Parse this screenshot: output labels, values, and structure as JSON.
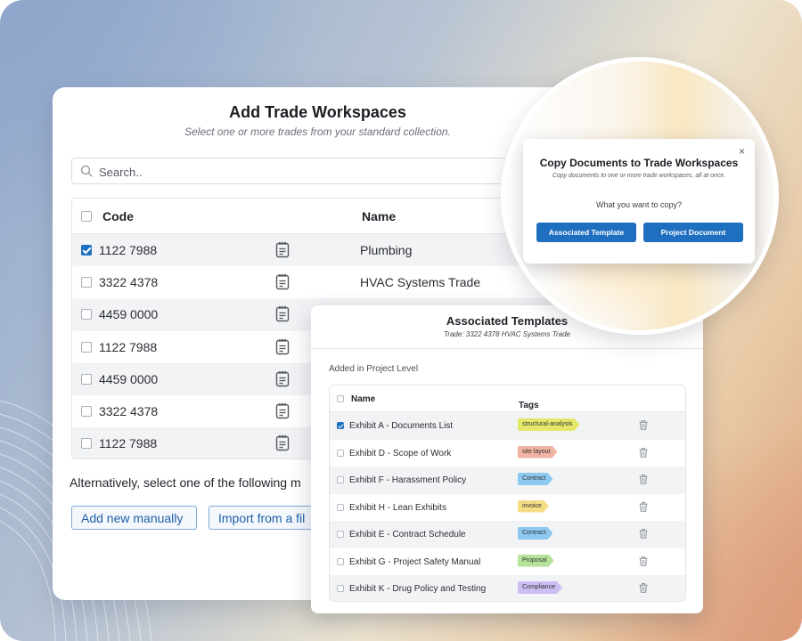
{
  "main": {
    "title": "Add Trade Workspaces",
    "subtitle": "Select one or more trades from your standard collection.",
    "search_placeholder": "Search..",
    "table": {
      "code_header": "Code",
      "name_header": "Name",
      "rows": [
        {
          "code": "1122 7988",
          "name": "Plumbing",
          "checked": true
        },
        {
          "code": "3322 4378",
          "name": "HVAC Systems Trade",
          "checked": false
        },
        {
          "code": "4459 0000",
          "name": "",
          "checked": false
        },
        {
          "code": "1122 7988",
          "name": "",
          "checked": false
        },
        {
          "code": "4459 0000",
          "name": "",
          "checked": false
        },
        {
          "code": "3322 4378",
          "name": "",
          "checked": false
        },
        {
          "code": "1122 7988",
          "name": "",
          "checked": false
        }
      ]
    },
    "alt_text": "Alternatively, select one of the following m",
    "add_manually_label": "Add new manually",
    "import_label": "Import from a fil"
  },
  "assoc": {
    "title": "Associated Templates",
    "subtitle": "Trade: 3322 4378 HVAC Systems Trade",
    "section_label": "Added in Project Level",
    "name_header": "Name",
    "tags_header": "Tags",
    "rows": [
      {
        "name": "Exhibit A - Documents List",
        "tag": "structural-analysis",
        "tag_color": "#e4e86a",
        "checked": true
      },
      {
        "name": "Exhibit D - Scope of Work",
        "tag": "site layout",
        "tag_color": "#f1b3a3",
        "checked": false
      },
      {
        "name": "Exhibit F - Harassment Policy",
        "tag": "Contract",
        "tag_color": "#8ec9f2",
        "checked": false
      },
      {
        "name": "Exhibit H - Lean Exhibits",
        "tag": "invoice",
        "tag_color": "#f6dd84",
        "checked": false
      },
      {
        "name": "Exhibit E - Contract Schedule",
        "tag": "Contract",
        "tag_color": "#8ec9f2",
        "checked": false
      },
      {
        "name": "Exhibit G - Project Safety Manual",
        "tag": "Proposal",
        "tag_color": "#b6e39a",
        "checked": false
      },
      {
        "name": "Exhibit K - Drug Policy and Testing",
        "tag": "Compliance",
        "tag_color": "#cdbdf2",
        "checked": false
      }
    ]
  },
  "copy_dialog": {
    "title": "Copy Documents to Trade Workspaces",
    "subtitle": "Copy documents to one or more trade workspaces, all at once.",
    "question": "What you want to copy?",
    "associated_template_label": "Associated Template",
    "project_document_label": "Project Document",
    "close_symbol": "×"
  },
  "colors": {
    "primary": "#1e6fbf",
    "checkbox_checked": "#1e6fbf"
  }
}
